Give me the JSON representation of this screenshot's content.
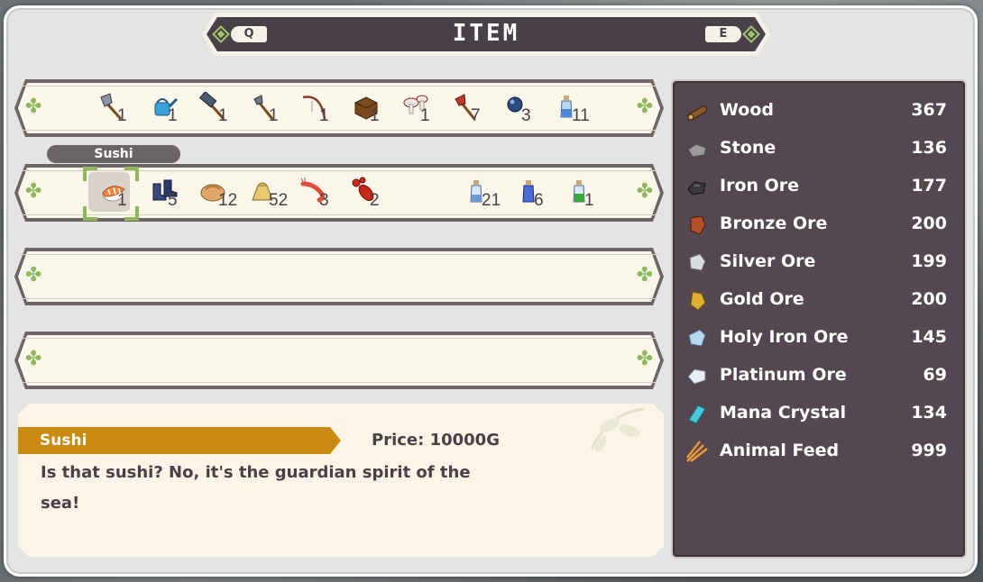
{
  "title": {
    "text": "ITEM",
    "left_key": "Q",
    "right_key": "E"
  },
  "rows": [
    {
      "slots": [
        {
          "icon": "axe-icon",
          "qty": "1"
        },
        {
          "icon": "watering-can-icon",
          "qty": "1"
        },
        {
          "icon": "hammer-icon",
          "qty": "1"
        },
        {
          "icon": "small-axe-icon",
          "qty": "1"
        },
        {
          "icon": "fishing-rod-icon",
          "qty": "1"
        },
        {
          "icon": "box-icon",
          "qty": "1"
        },
        {
          "icon": "mushrooms-icon",
          "qty": "1"
        },
        {
          "icon": "red-axe-icon",
          "qty": "7"
        },
        {
          "icon": "blue-orb-icon",
          "qty": "3"
        },
        {
          "icon": "potion-icon",
          "qty": "11"
        }
      ]
    },
    {
      "slots": [
        {
          "icon": "sushi-icon",
          "qty": "1"
        },
        {
          "icon": "boots-icon",
          "qty": "5"
        },
        {
          "icon": "bread-icon",
          "qty": "12"
        },
        {
          "icon": "seed-bag-icon",
          "qty": "52"
        },
        {
          "icon": "shrimp-icon",
          "qty": "3"
        },
        {
          "icon": "lobster-icon",
          "qty": "2"
        },
        {
          "icon": "blue-potion-icon",
          "qty": "21"
        },
        {
          "icon": "blue-bottle-icon",
          "qty": "6"
        },
        {
          "icon": "green-potion-icon",
          "qty": "1"
        }
      ]
    }
  ],
  "tooltip": "Sushi",
  "details": {
    "name": "Sushi",
    "price": "Price: 10000G",
    "line1": "Is that sushi? No, it's the guardian spirit of the",
    "line2": "sea!"
  },
  "materials": [
    {
      "name": "Wood",
      "count": "367",
      "icon": "wood-icon",
      "color": "#8a5a2a"
    },
    {
      "name": "Stone",
      "count": "136",
      "icon": "stone-icon",
      "color": "#9a9898"
    },
    {
      "name": "Iron Ore",
      "count": "177",
      "icon": "iron-ore-icon",
      "color": "#3a3a3e"
    },
    {
      "name": "Bronze Ore",
      "count": "200",
      "icon": "bronze-ore-icon",
      "color": "#b4502a"
    },
    {
      "name": "Silver Ore",
      "count": "199",
      "icon": "silver-ore-icon",
      "color": "#d8dce0"
    },
    {
      "name": "Gold Ore",
      "count": "200",
      "icon": "gold-ore-icon",
      "color": "#e0b030"
    },
    {
      "name": "Holy Iron Ore",
      "count": "145",
      "icon": "holy-iron-ore-icon",
      "color": "#b8d8f0"
    },
    {
      "name": "Platinum Ore",
      "count": "69",
      "icon": "platinum-ore-icon",
      "color": "#e8eef6"
    },
    {
      "name": "Mana Crystal",
      "count": "134",
      "icon": "mana-crystal-icon",
      "color": "#48c8d8"
    },
    {
      "name": "Animal Feed",
      "count": "999",
      "icon": "animal-feed-icon",
      "color": "#e89a38"
    }
  ]
}
